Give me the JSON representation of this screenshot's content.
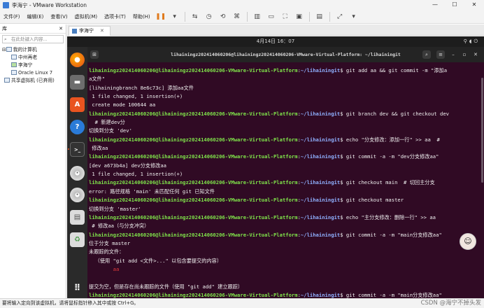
{
  "window": {
    "title": "李海宁 - VMware Workstation",
    "minimize": "—",
    "maximize": "☐",
    "close": "✕"
  },
  "menu": [
    "文件(F)",
    "编辑(E)",
    "查看(V)",
    "虚拟机(M)",
    "选项卡(T)",
    "帮助(H)"
  ],
  "library": {
    "title": "库",
    "search_placeholder": "在此处键入内容...",
    "tree": [
      "我的计算机",
      "中州再老",
      "李海宁",
      "Oracle Linux 7",
      "共享虚拟机 (已弃用)"
    ]
  },
  "tab": {
    "label": "李海宁"
  },
  "desktop": {
    "clock": "4月14日 16：07"
  },
  "terminal": {
    "title": "lihainingz202414060206@lihainingz202414060206-VMware-Virtual-Platform: ~/lihainingit",
    "user": "lihainingz202414060206@lihainingz202414060206-VMware-Virtual-Platform",
    "path": "~/lihainingit",
    "lines": [
      {
        "t": "cmd",
        "c": " git add aa && git commit -m \"添加a"
      },
      {
        "t": "out",
        "c": "a文件\""
      },
      {
        "t": "out",
        "c": "[lihainingbranch 8e6c73c] 添加aa文件"
      },
      {
        "t": "out",
        "c": " 1 file changed, 1 insertion(+)"
      },
      {
        "t": "out",
        "c": " create mode 100644 aa"
      },
      {
        "t": "cmd",
        "c": " git branch dev && git checkout dev"
      },
      {
        "t": "out",
        "c": "  # 新建dev分"
      },
      {
        "t": "out",
        "c": "切换到分支 'dev'"
      },
      {
        "t": "cmd",
        "c": " echo \"分支修改：添加一行\" >> aa  #"
      },
      {
        "t": "out",
        "c": " 修改aa"
      },
      {
        "t": "cmd",
        "c": " git commit -a -m \"dev分支修改aa\""
      },
      {
        "t": "out",
        "c": "[dev a673b4a] dev分支修改aa"
      },
      {
        "t": "out",
        "c": " 1 file changed, 1 insertion(+)"
      },
      {
        "t": "cmd",
        "c": " git checkout main  # 切回主分支"
      },
      {
        "t": "out",
        "c": "error: 路径规格 'main' 未匹配任何 git 已知文件"
      },
      {
        "t": "cmd",
        "c": " git checkout master"
      },
      {
        "t": "out",
        "c": "切换到分支 'master'"
      },
      {
        "t": "cmd",
        "c": " echo \"主分支修改：删除一行\" >> aa"
      },
      {
        "t": "out",
        "c": " # 修改aa（与分支冲突）"
      },
      {
        "t": "cmd",
        "c": " git commit -a -m \"main分支修改aa\""
      },
      {
        "t": "out",
        "c": "位于分支 master"
      },
      {
        "t": "out",
        "c": "未跟踪的文件："
      },
      {
        "t": "out",
        "c": "  （使用 \"git add <文件>...\" 以包含要提交的内容）"
      },
      {
        "t": "red",
        "c": "        aa"
      },
      {
        "t": "out",
        "c": ""
      },
      {
        "t": "out",
        "c": "提交为空，但是存在尚未跟踪的文件（使用 \"git add\" 建立跟踪）"
      },
      {
        "t": "cmd",
        "c": " git commit -a -m \"main分支修改aa\""
      }
    ]
  },
  "statusbar": {
    "text": "要将输入定向到该虚拟机，请将鼠标指针移入其中或按 Ctrl+G。"
  },
  "watermark": "CSDN @海宁不掉头发",
  "colors": {
    "terminal_bg": "#300a24",
    "prompt_user": "#7fe34a",
    "prompt_path": "#8fb0ff",
    "accent_orange": "#e95420"
  }
}
